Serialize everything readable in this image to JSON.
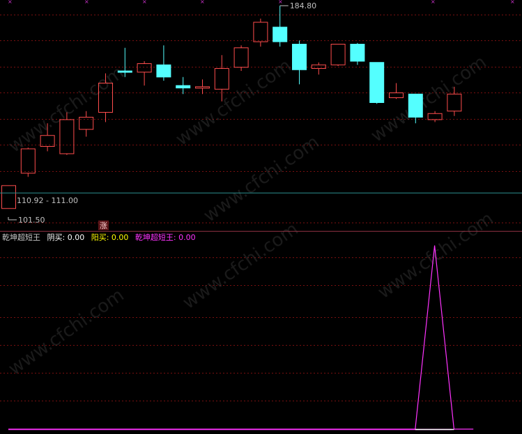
{
  "colors": {
    "background": "#000000",
    "up": "#ff4d4d",
    "down": "#54ffff",
    "grid": "#7a1010",
    "separator": "#8a3040",
    "border": "#2a8a8a",
    "indicator": "#ff33ff",
    "yinmai": "#ffffff",
    "yangmai": "#ffff00",
    "label": "#c0c0c0"
  },
  "watermark": "www.cfchi.com",
  "top_marks": "×",
  "price_panel": {
    "high_label": "184.80",
    "range_label": "110.92 - 111.00",
    "low_label": "101.50",
    "signal_badge": "涨"
  },
  "indicator_panel": {
    "legend": [
      {
        "key": "name",
        "text": "乾坤超短王",
        "color": "#c8c8c8"
      },
      {
        "key": "yinmai",
        "text": "阴买: 0.00",
        "color": "#ffffff"
      },
      {
        "key": "yangmai",
        "text": "阳买: 0.00",
        "color": "#ffff00"
      },
      {
        "key": "main",
        "text": "乾坤超短王: 0.00",
        "color": "#ff33ff"
      }
    ]
  },
  "chart_data": [
    {
      "type": "candlestick",
      "title": "",
      "ylim": [
        98,
        186
      ],
      "candles": [
        {
          "o": 101.5,
          "h": 111.0,
          "l": 101.5,
          "c": 110.9,
          "dir": "up"
        },
        {
          "o": 116.0,
          "h": 126.5,
          "l": 114.5,
          "c": 126.0,
          "dir": "up"
        },
        {
          "o": 127.0,
          "h": 136.5,
          "l": 125.0,
          "c": 131.5,
          "dir": "up"
        },
        {
          "o": 124.0,
          "h": 141.0,
          "l": 123.5,
          "c": 138.0,
          "dir": "up"
        },
        {
          "o": 134.0,
          "h": 141.5,
          "l": 131.0,
          "c": 139.0,
          "dir": "up"
        },
        {
          "o": 141.0,
          "h": 157.0,
          "l": 137.0,
          "c": 153.0,
          "dir": "up"
        },
        {
          "o": 158.0,
          "h": 167.5,
          "l": 155.5,
          "c": 157.5,
          "dir": "down"
        },
        {
          "o": 157.5,
          "h": 162.0,
          "l": 152.0,
          "c": 161.0,
          "dir": "up"
        },
        {
          "o": 160.5,
          "h": 168.5,
          "l": 154.0,
          "c": 155.5,
          "dir": "down"
        },
        {
          "o": 152.0,
          "h": 155.5,
          "l": 148.5,
          "c": 151.0,
          "dir": "down"
        },
        {
          "o": 151.0,
          "h": 154.5,
          "l": 148.5,
          "c": 151.5,
          "dir": "up"
        },
        {
          "o": 150.5,
          "h": 164.5,
          "l": 145.5,
          "c": 159.0,
          "dir": "up"
        },
        {
          "o": 159.5,
          "h": 168.5,
          "l": 158.0,
          "c": 167.5,
          "dir": "up"
        },
        {
          "o": 170.0,
          "h": 179.5,
          "l": 168.0,
          "c": 178.0,
          "dir": "up"
        },
        {
          "o": 176.0,
          "h": 184.8,
          "l": 168.0,
          "c": 170.0,
          "dir": "down"
        },
        {
          "o": 169.0,
          "h": 170.5,
          "l": 152.5,
          "c": 158.5,
          "dir": "down"
        },
        {
          "o": 159.0,
          "h": 161.5,
          "l": 156.5,
          "c": 160.5,
          "dir": "up"
        },
        {
          "o": 160.5,
          "h": 169.0,
          "l": 160.0,
          "c": 169.0,
          "dir": "up"
        },
        {
          "o": 169.0,
          "h": 169.5,
          "l": 160.5,
          "c": 162.0,
          "dir": "down"
        },
        {
          "o": 161.5,
          "h": 161.5,
          "l": 144.5,
          "c": 145.0,
          "dir": "down"
        },
        {
          "o": 147.0,
          "h": 153.0,
          "l": 146.5,
          "c": 149.0,
          "dir": "up"
        },
        {
          "o": 148.5,
          "h": 148.5,
          "l": 136.5,
          "c": 139.0,
          "dir": "down"
        },
        {
          "o": 138.0,
          "h": 141.5,
          "l": 137.0,
          "c": 140.5,
          "dir": "up"
        },
        {
          "o": 141.5,
          "h": 151.5,
          "l": 139.5,
          "c": 148.5,
          "dir": "up"
        }
      ]
    },
    {
      "type": "line",
      "title": "乾坤超短王",
      "ylim": [
        0,
        1
      ],
      "series": [
        {
          "name": "乾坤超短王",
          "values": [
            0,
            0,
            0,
            0,
            0,
            0,
            0,
            0,
            0,
            0,
            0,
            0,
            0,
            0,
            0,
            0,
            0,
            0,
            0,
            0,
            0,
            0,
            1,
            0,
            0
          ]
        },
        {
          "name": "阴买",
          "values": [
            0,
            0,
            0,
            0,
            0,
            0,
            0,
            0,
            0,
            0,
            0,
            0,
            0,
            0,
            0,
            0,
            0,
            0,
            0,
            0,
            0,
            0,
            0,
            0,
            0
          ]
        },
        {
          "name": "阳买",
          "values": [
            0,
            0,
            0,
            0,
            0,
            0,
            0,
            0,
            0,
            0,
            0,
            0,
            0,
            0,
            0,
            0,
            0,
            0,
            0,
            0,
            0,
            0,
            0,
            0,
            0
          ]
        }
      ]
    }
  ]
}
